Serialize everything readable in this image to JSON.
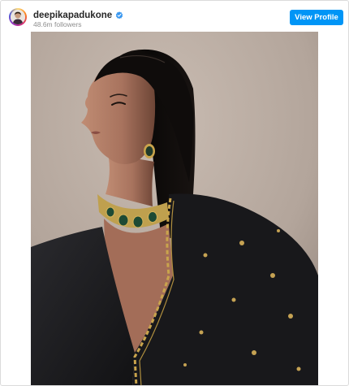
{
  "post": {
    "account": {
      "username": "deepikapadukone",
      "verified_icon": "verified-badge-icon",
      "followers": "48.6m followers"
    },
    "view_profile_label": "View Profile",
    "photo": {
      "subject": "portrait photo of woman in black outfit with emerald choker",
      "interactable": true
    }
  },
  "colors": {
    "button_blue": "#0095f6",
    "username_text": "#262626",
    "secondary_text": "#8e8e8e",
    "border": "#dbdbdb",
    "photo_background": "#b8aaa0"
  }
}
